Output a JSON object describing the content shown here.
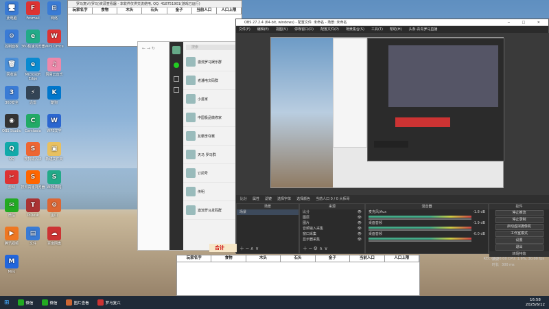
{
  "desktop": {
    "icons": [
      {
        "label": "此电脑",
        "color": "#3a7bd5",
        "g": "🖥"
      },
      {
        "label": "Foxmail",
        "color": "#d33",
        "g": "F"
      },
      {
        "label": "网络",
        "color": "#3a7bd5",
        "g": "⊞"
      },
      {
        "label": "控制面板",
        "color": "#3a7bd5",
        "g": "⚙"
      },
      {
        "label": "360极速浏览器",
        "color": "#2a8",
        "g": "e"
      },
      {
        "label": "WPS Office",
        "color": "#d33",
        "g": "W"
      },
      {
        "label": "回收站",
        "color": "#4a8fd8",
        "g": "🗑"
      },
      {
        "label": "Microsoft Edge",
        "color": "#0a8ad0",
        "g": "e"
      },
      {
        "label": "网易云音乐",
        "color": "#e8a",
        "g": "♫"
      },
      {
        "label": "360安全",
        "color": "#3a7bd5",
        "g": "3"
      },
      {
        "label": "迅雷",
        "color": "#345",
        "g": "⚡"
      },
      {
        "label": "酷狗",
        "color": "#07c",
        "g": "K"
      },
      {
        "label": "OBS Studio",
        "color": "#333",
        "g": "◉"
      },
      {
        "label": "Camtasia",
        "color": "#2a6",
        "g": "C"
      },
      {
        "label": "WPS文字",
        "color": "#2b66d0",
        "g": "W"
      },
      {
        "label": "QQ",
        "color": "#1aa",
        "g": "Q"
      },
      {
        "label": "搜狗输入法",
        "color": "#e63",
        "g": "S"
      },
      {
        "label": "新建文件夹",
        "color": "#e8c060",
        "g": "▣"
      },
      {
        "label": "剪映",
        "color": "#d33",
        "g": "✂"
      },
      {
        "label": "搜狗高速浏览器",
        "color": "#f60",
        "g": "S"
      },
      {
        "label": "WPS表格",
        "color": "#2a8",
        "g": "S"
      },
      {
        "label": "微信",
        "color": "#2a2",
        "g": "✉"
      },
      {
        "label": "ToDesk",
        "color": "#a33",
        "g": "T"
      },
      {
        "label": "金山",
        "color": "#d63",
        "g": "⚙"
      },
      {
        "label": "腾讯视频",
        "color": "#e72",
        "g": "▶"
      },
      {
        "label": "文件",
        "color": "#3a7bd5",
        "g": "▤"
      },
      {
        "label": "百度网盘",
        "color": "#c33",
        "g": "☁"
      },
      {
        "label": "Miro",
        "color": "#26d",
        "g": "M"
      }
    ]
  },
  "sheet_top": {
    "title": "罗马复兴(罗马)资源查看器 - 本软件仅供交流使用, QQ: 418751901(游戏已运行)",
    "headers": [
      "玩家名字",
      "食物",
      "木头",
      "石头",
      "金子",
      "当前人口",
      "人口上限"
    ]
  },
  "sheet_bottom": {
    "headers": [
      "玩家名字",
      "食物",
      "木头",
      "石头",
      "金子",
      "当前人口",
      "人口上限"
    ],
    "total_label": "合计"
  },
  "chat": {
    "search_placeholder": "搜索",
    "items": [
      {
        "name": "激流罗马娱乐群"
      },
      {
        "name": "老潘电文码群"
      },
      {
        "name": "小曼家"
      },
      {
        "name": "中国极品微修家"
      },
      {
        "name": "友霸李夺赛"
      },
      {
        "name": "天马 罗马群"
      },
      {
        "name": "订阅号"
      },
      {
        "name": "传明"
      },
      {
        "name": "激流罗马发码群"
      }
    ]
  },
  "obs": {
    "title": "OBS 27.2.4 (64-bit, windows) - 配置文件: 未命名 - 场景: 未命名",
    "menu": [
      "文件(F)",
      "编辑(E)",
      "视图(V)",
      "停靠窗口(D)",
      "配置文件(P)",
      "场景集合(S)",
      "工具(T)",
      "帮助(H)",
      "头条-青青罗马直播"
    ],
    "source_bar": {
      "name": "比分",
      "props": "属性",
      "filters": "滤镜",
      "font": "选择字体",
      "color": "选择颜色",
      "text": "当前人口 0 / 0 大师哥"
    },
    "scenes": {
      "title": "场景",
      "items": [
        "场景"
      ]
    },
    "sources": {
      "title": "来源",
      "items": [
        "比分",
        "图层",
        "图片",
        "音频输入采集",
        "窗口采集",
        "显示器采集"
      ]
    },
    "mixer": {
      "title": "混音器",
      "channels": [
        {
          "name": "麦克风/Aux",
          "db": "-1.8 dB"
        },
        {
          "name": "桌面音频",
          "db": "-1.9 dB"
        },
        {
          "name": "桌面音频",
          "db": "-0.0 dB"
        }
      ]
    },
    "transitions": {
      "title": "转场特效",
      "mode": "渐变",
      "duration_label": "时长",
      "duration": "300 ms"
    },
    "controls": {
      "title": "控件",
      "buttons": [
        "停止推流",
        "停止录制",
        "启动虚拟摄像机",
        "工作室模式",
        "设置",
        "退出"
      ]
    },
    "status": "REC 00:00:00  CPU: 1.9%, 30.00 fps"
  },
  "taskbar": {
    "items": [
      "微信",
      "微信",
      "图片查看",
      "罗马复兴"
    ],
    "time": "16:58",
    "date": "2025/6/12"
  }
}
